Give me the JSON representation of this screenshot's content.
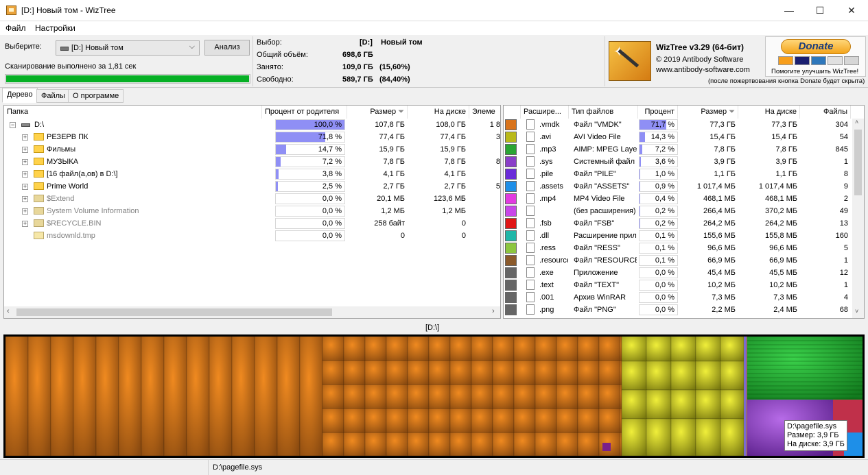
{
  "window": {
    "title": "[D:] Новый том  - WizTree",
    "minimize": "—",
    "maximize": "☐",
    "close": "✕"
  },
  "menu": {
    "file": "Файл",
    "settings": "Настройки"
  },
  "toolbar": {
    "select_label": "Выберите:",
    "drive_value": "[D:] Новый том",
    "analyze_label": "Анализ",
    "scan_status": "Сканирование выполнено за 1,81 сек",
    "progress_fraction": 1.0,
    "progress_color": "#06b025"
  },
  "info": {
    "selection_label": "Выбор:",
    "selection_drive": "[D:]",
    "selection_name": "Новый том",
    "total_label": "Общий объём:",
    "total_value": "698,6 ГБ",
    "used_label": "Занято:",
    "used_value": "109,0 ГБ",
    "used_pct": "(15,60%)",
    "free_label": "Свободно:",
    "free_value": "589,7 ГБ",
    "free_pct": "(84,40%)"
  },
  "about": {
    "product": "WizTree v3.29 (64-бит)",
    "copyright": "© 2019 Antibody Software",
    "website": "www.antibody-software.com",
    "donate_label": "Donate",
    "donate_caption": "Помогите улучшить WizTree!",
    "donate_note": "(после пожертвования кнопка Donate будет скрыта)"
  },
  "tabs": [
    {
      "label": "Дерево"
    },
    {
      "label": "Файлы"
    },
    {
      "label": "О программе"
    }
  ],
  "tree": {
    "columns": {
      "folder": "Папка",
      "pct": "Процент от родителя",
      "size": "Размер",
      "disk": "На диске",
      "items": "Элеме"
    },
    "rows": [
      {
        "name": "D:\\",
        "pct": 1.0,
        "pct_text": "100,0 %",
        "size": "107,8 ГБ",
        "disk": "108,0 ГБ",
        "items": "1 8",
        "kind": "drive"
      },
      {
        "name": "РЕЗЕРВ ПК",
        "pct": 0.718,
        "pct_text": "71,8 %",
        "size": "77,4 ГБ",
        "disk": "77,4 ГБ",
        "items": "3",
        "kind": "folder"
      },
      {
        "name": "Фильмы",
        "pct": 0.147,
        "pct_text": "14,7 %",
        "size": "15,9 ГБ",
        "disk": "15,9 ГБ",
        "items": "",
        "kind": "folder"
      },
      {
        "name": "МУЗЫКА",
        "pct": 0.072,
        "pct_text": "7,2 %",
        "size": "7,8 ГБ",
        "disk": "7,8 ГБ",
        "items": "8",
        "kind": "folder"
      },
      {
        "name": "[16 файл(а,ов) в D:\\]",
        "pct": 0.038,
        "pct_text": "3,8 %",
        "size": "4,1 ГБ",
        "disk": "4,1 ГБ",
        "items": "",
        "kind": "files"
      },
      {
        "name": "Prime World",
        "pct": 0.025,
        "pct_text": "2,5 %",
        "size": "2,7 ГБ",
        "disk": "2,7 ГБ",
        "items": "5",
        "kind": "folder"
      },
      {
        "name": "$Extend",
        "pct": 0.0,
        "pct_text": "0,0 %",
        "size": "20,1 МБ",
        "disk": "123,6 МБ",
        "items": "",
        "kind": "sys"
      },
      {
        "name": "System Volume Information",
        "pct": 0.0,
        "pct_text": "0,0 %",
        "size": "1,2 МБ",
        "disk": "1,2 МБ",
        "items": "",
        "kind": "sys"
      },
      {
        "name": "$RECYCLE.BIN",
        "pct": 0.0,
        "pct_text": "0,0 %",
        "size": "258 байт",
        "disk": "0",
        "items": "",
        "kind": "sys"
      },
      {
        "name": "msdownld.tmp",
        "pct": 0.0,
        "pct_text": "0,0 %",
        "size": "0",
        "disk": "0",
        "items": "",
        "kind": "tmp"
      }
    ]
  },
  "types": {
    "columns": {
      "ext": "Расшире...",
      "type": "Тип файлов",
      "pct": "Процент",
      "size": "Размер",
      "disk": "На диске",
      "files": "Файлы"
    },
    "rows": [
      {
        "color": "#d9741c",
        "ext": ".vmdk",
        "type": "Файл \"VMDK\"",
        "pct": 0.717,
        "pct_text": "71,7 %",
        "size": "77,3 ГБ",
        "disk": "77,3 ГБ",
        "files": "304"
      },
      {
        "color": "#b9b91a",
        "ext": ".avi",
        "type": "AVI Video File",
        "pct": 0.143,
        "pct_text": "14,3 %",
        "size": "15,4 ГБ",
        "disk": "15,4 ГБ",
        "files": "54"
      },
      {
        "color": "#2aa533",
        "ext": ".mp3",
        "type": "AIMP: MPEG Layer",
        "pct": 0.072,
        "pct_text": "7,2 %",
        "size": "7,8 ГБ",
        "disk": "7,8 ГБ",
        "files": "845"
      },
      {
        "color": "#8a3ec9",
        "ext": ".sys",
        "type": "Системный файл",
        "pct": 0.036,
        "pct_text": "3,6 %",
        "size": "3,9 ГБ",
        "disk": "3,9 ГБ",
        "files": "1"
      },
      {
        "color": "#6a2bd9",
        "ext": ".pile",
        "type": "Файл \"PILE\"",
        "pct": 0.01,
        "pct_text": "1,0 %",
        "size": "1,1 ГБ",
        "disk": "1,1 ГБ",
        "files": "8"
      },
      {
        "color": "#1e8fe8",
        "ext": ".assets",
        "type": "Файл \"ASSETS\"",
        "pct": 0.009,
        "pct_text": "0,9 %",
        "size": "1 017,4 МБ",
        "disk": "1 017,4 МБ",
        "files": "9"
      },
      {
        "color": "#e23be0",
        "ext": ".mp4",
        "type": "MP4 Video File",
        "pct": 0.004,
        "pct_text": "0,4 %",
        "size": "468,1 МБ",
        "disk": "468,1 МБ",
        "files": "2"
      },
      {
        "color": "#c846e8",
        "ext": "",
        "type": "(без расширения)",
        "pct": 0.002,
        "pct_text": "0,2 %",
        "size": "266,4 МБ",
        "disk": "370,2 МБ",
        "files": "49"
      },
      {
        "color": "#e01515",
        "ext": ".fsb",
        "type": "Файл \"FSB\"",
        "pct": 0.002,
        "pct_text": "0,2 %",
        "size": "264,2 МБ",
        "disk": "264,2 МБ",
        "files": "13"
      },
      {
        "color": "#1fb7a8",
        "ext": ".dll",
        "type": "Расширение прил",
        "pct": 0.001,
        "pct_text": "0,1 %",
        "size": "155,6 МБ",
        "disk": "155,8 МБ",
        "files": "160"
      },
      {
        "color": "#8cc63f",
        "ext": ".ress",
        "type": "Файл \"RESS\"",
        "pct": 0.001,
        "pct_text": "0,1 %",
        "size": "96,6 МБ",
        "disk": "96,6 МБ",
        "files": "5"
      },
      {
        "color": "#8b5a2b",
        "ext": ".resource",
        "type": "Файл \"RESOURCE",
        "pct": 0.001,
        "pct_text": "0,1 %",
        "size": "66,9 МБ",
        "disk": "66,9 МБ",
        "files": "1"
      },
      {
        "color": "#666666",
        "ext": ".exe",
        "type": "Приложение",
        "pct": 0.0,
        "pct_text": "0,0 %",
        "size": "45,4 МБ",
        "disk": "45,5 МБ",
        "files": "12"
      },
      {
        "color": "#666666",
        "ext": ".text",
        "type": "Файл \"TEXT\"",
        "pct": 0.0,
        "pct_text": "0,0 %",
        "size": "10,2 МБ",
        "disk": "10,2 МБ",
        "files": "1"
      },
      {
        "color": "#666666",
        "ext": ".001",
        "type": "Архив WinRAR",
        "pct": 0.0,
        "pct_text": "0,0 %",
        "size": "7,3 МБ",
        "disk": "7,3 МБ",
        "files": "4"
      },
      {
        "color": "#666666",
        "ext": ".png",
        "type": "Файл \"PNG\"",
        "pct": 0.0,
        "pct_text": "0,0 %",
        "size": "2,2 МБ",
        "disk": "2,4 МБ",
        "files": "68"
      }
    ]
  },
  "treemap": {
    "path_label": "[D:\\]",
    "tooltip": {
      "line1": "D:\\pagefile.sys",
      "line2": "Размер: 3,9 ГБ",
      "line3": "На диске: 3,9 ГБ"
    }
  },
  "statusbar": {
    "path": "D:\\pagefile.sys"
  }
}
